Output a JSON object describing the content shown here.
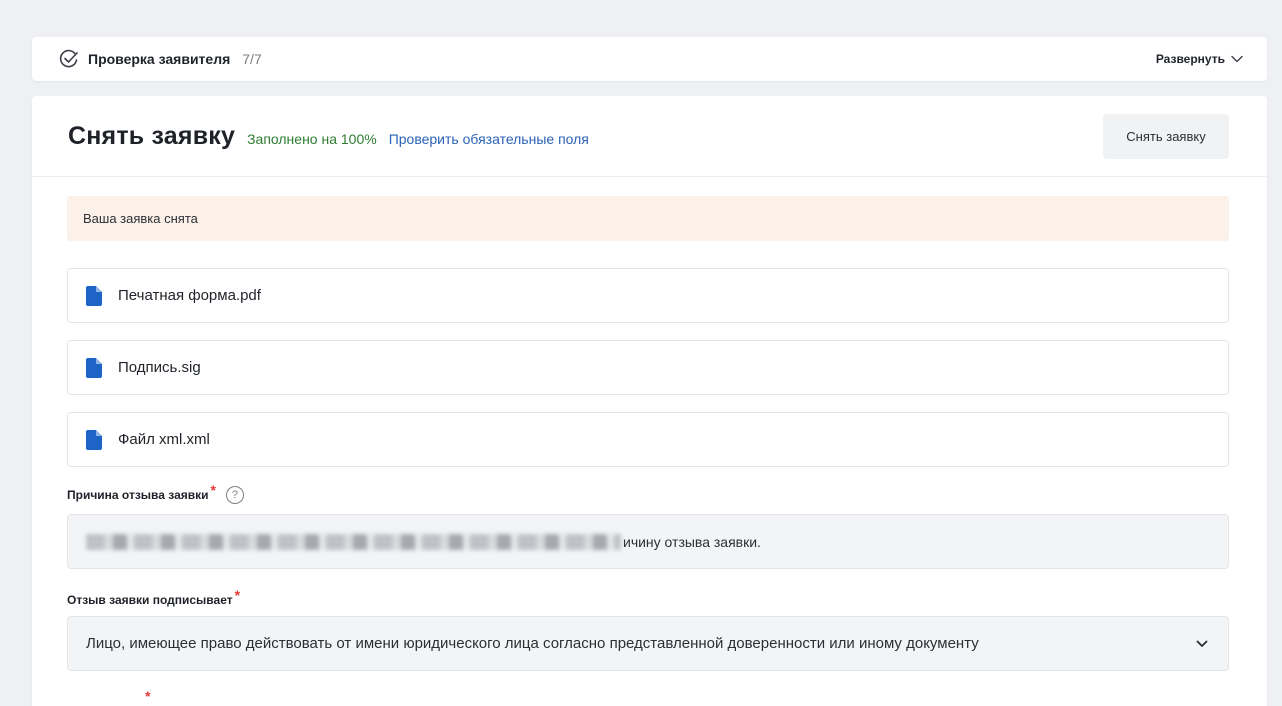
{
  "applicant_check": {
    "title": "Проверка заявителя",
    "count": "7/7",
    "expand_label": "Развернуть"
  },
  "header": {
    "title": "Снять заявку",
    "fill_status": "Заполнено на 100%",
    "check_link": "Проверить обязательные поля",
    "withdraw_button": "Снять заявку"
  },
  "notice": "Ваша заявка снята",
  "files": [
    {
      "name": "Печатная форма.pdf",
      "icon": "file-icon"
    },
    {
      "name": "Подпись.sig",
      "icon": "file-icon"
    },
    {
      "name": "Файл xml.xml",
      "icon": "file-icon"
    }
  ],
  "reason_field": {
    "label": "Причина отзыва заявки",
    "required_mark": "*",
    "value_visible_tail": "ичину отзыва заявки."
  },
  "signer_field": {
    "label": "Отзыв заявки подписывает",
    "required_mark": "*",
    "selected": "Лицо, имеющее право действовать от имени юридического лица согласно представленной доверенности или иному документу"
  },
  "next_field": {
    "required_mark": "*"
  },
  "colors": {
    "page_bg": "#eef0f4",
    "card_bg": "#ffffff",
    "success": "#2e7d32",
    "link": "#2a62b6",
    "notice_bg": "#fcf1e8",
    "required": "#e53935",
    "file_icon": "#1e63c6"
  }
}
